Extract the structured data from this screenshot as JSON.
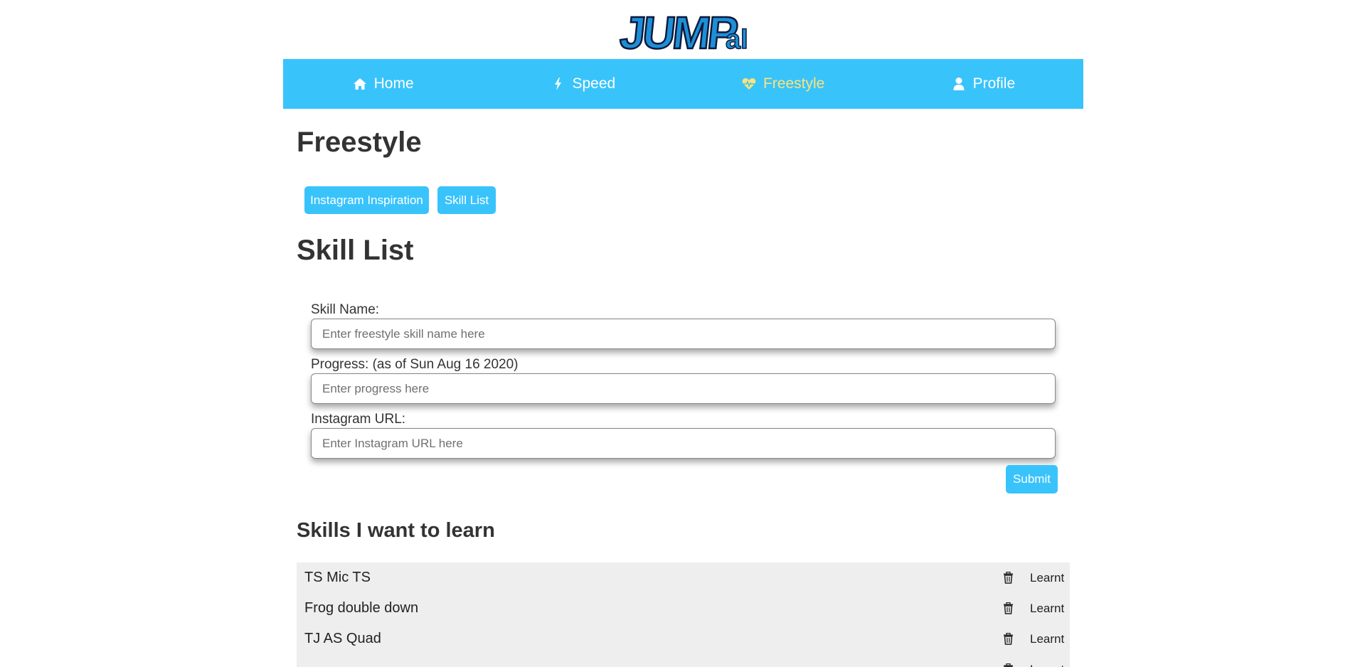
{
  "logo": {
    "text_main": "JUMP",
    "text_small": "al"
  },
  "nav": {
    "items": [
      {
        "label": "Home",
        "icon": "home-icon"
      },
      {
        "label": "Speed",
        "icon": "bolt-icon"
      },
      {
        "label": "Freestyle",
        "icon": "heartbeat-icon",
        "active": true
      },
      {
        "label": "Profile",
        "icon": "user-icon"
      }
    ]
  },
  "page": {
    "title": "Freestyle",
    "buttons": {
      "instagram": "Instagram Inspiration",
      "skill_list": "Skill List"
    },
    "section_title": "Skill List"
  },
  "form": {
    "skill_name_label": "Skill Name:",
    "skill_name_placeholder": "Enter freestyle skill name here",
    "progress_label": "Progress: (as of Sun Aug 16 2020)",
    "progress_placeholder": "Enter progress here",
    "instagram_label": "Instagram URL:",
    "instagram_placeholder": "Enter Instagram URL here",
    "submit_label": "Submit"
  },
  "skills": {
    "title": "Skills I want to learn",
    "learnt_label": "Learnt",
    "items": [
      {
        "name": "TS Mic TS"
      },
      {
        "name": "Frog double down"
      },
      {
        "name": "TJ AS Quad"
      },
      {
        "name": "..."
      }
    ]
  },
  "colors": {
    "accent": "#39c3fb",
    "active_nav": "#fbe37a",
    "list_bg": "#eeeeee"
  }
}
